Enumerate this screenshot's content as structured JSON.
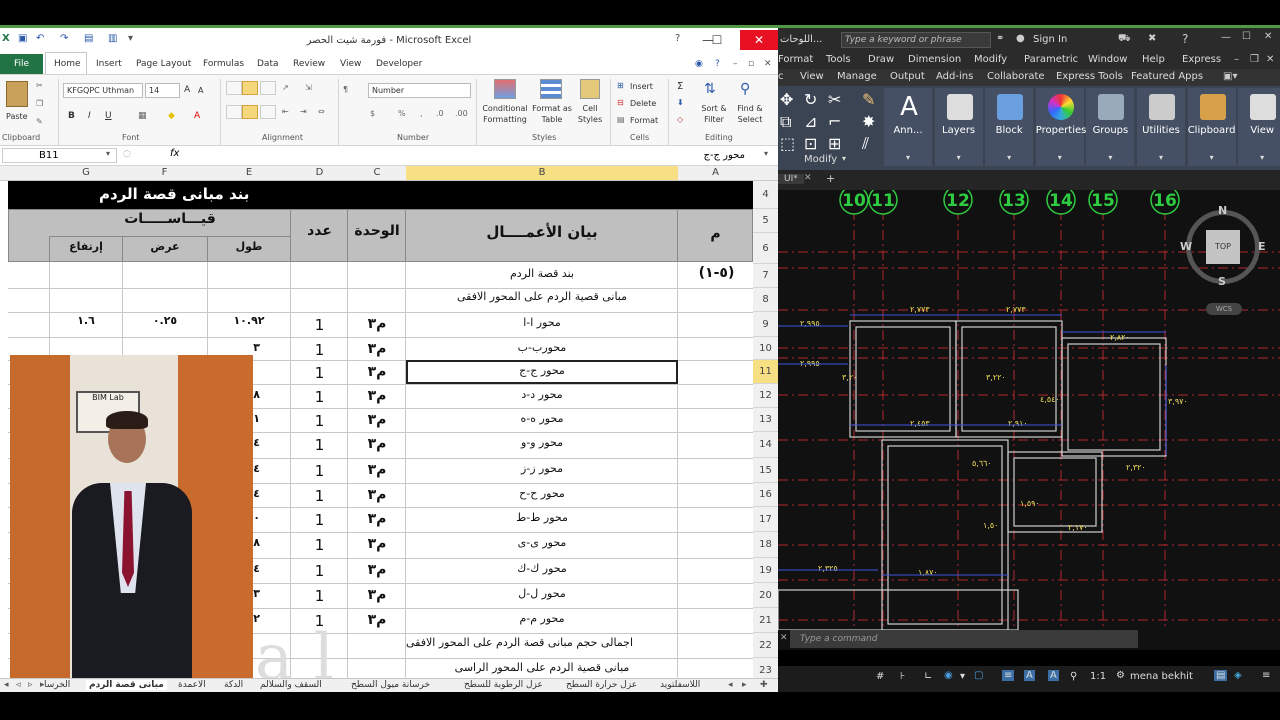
{
  "excel": {
    "title": "فورمة شيت الحصر - Microsoft Excel",
    "tabs": [
      "File",
      "Home",
      "Insert",
      "Page Layout",
      "Formulas",
      "Data",
      "Review",
      "View",
      "Developer"
    ],
    "font_name": "KFGQPC Uthman",
    "font_size": "14",
    "number_format": "Number",
    "groups": [
      "Clipboard",
      "Font",
      "Alignment",
      "Number",
      "Styles",
      "Cells",
      "Editing"
    ],
    "ribbon_labels": {
      "paste": "Paste",
      "conditional": "Conditional Formatting",
      "format_table": "Format as Table",
      "cell_styles": "Cell Styles",
      "insert": "Insert",
      "delete": "Delete",
      "format": "Format",
      "sort": "Sort & Filter",
      "find": "Find & Select"
    },
    "name_box": "B11",
    "formula": "محور ج-ج",
    "columns": [
      "G",
      "F",
      "E",
      "D",
      "C",
      "B",
      "A"
    ],
    "header_title": "بند مبانى قصة الردم",
    "header_m": "م",
    "header_desc": "بيان الأعمــــال",
    "header_unit": "الوحدة",
    "header_count": "عدد",
    "header_measure": "قيـــاســـــات",
    "header_length": "طول",
    "header_width": "عرض",
    "header_height": "إرتفاع",
    "item_no": "(٥-١)",
    "row7": "بند قصة الردم",
    "row8": "مبانى قصية الردم على المحور الافقى",
    "row9_length": "١٠.٩٢",
    "row9_width": "٠.٢٥",
    "row9_height": "١.٦",
    "axes": [
      {
        "row": "9",
        "name": "محور ا-ا",
        "unit": "م٣",
        "count": "1",
        "e": ""
      },
      {
        "row": "10",
        "name": "محورب-ب",
        "unit": "م٣",
        "count": "1",
        "e": "٣"
      },
      {
        "row": "11",
        "name": "محور ج-ج",
        "unit": "م٣",
        "count": "1",
        "e": ""
      },
      {
        "row": "12",
        "name": "محور د-د",
        "unit": "م٣",
        "count": "1",
        "e": "٦٨"
      },
      {
        "row": "13",
        "name": "محور ه-ه",
        "unit": "م٣",
        "count": "1",
        "e": "١"
      },
      {
        "row": "14",
        "name": "محور و-و",
        "unit": "م٣",
        "count": "1",
        "e": "٤"
      },
      {
        "row": "15",
        "name": "محور ز-ز",
        "unit": "م٣",
        "count": "1",
        "e": "٨٤"
      },
      {
        "row": "16",
        "name": "محور ح-ح",
        "unit": "م٣",
        "count": "1",
        "e": "٤"
      },
      {
        "row": "17",
        "name": "محور ط-ط",
        "unit": "م٣",
        "count": "1",
        "e": "٠"
      },
      {
        "row": "18",
        "name": "محور ى-ى",
        "unit": "م٣",
        "count": "1",
        "e": "٦٨"
      },
      {
        "row": "19",
        "name": "محور ك-ك",
        "unit": "م٣",
        "count": "1",
        "e": "٤"
      },
      {
        "row": "20",
        "name": "محور ل-ل",
        "unit": "م٣",
        "count": "1",
        "e": "٣"
      },
      {
        "row": "21",
        "name": "محور م-م",
        "unit": "م٣",
        "count": "1",
        "e": "٩٢"
      }
    ],
    "row22": "اجمالى حجم مبانى قصة الردم على المحور الافقى",
    "row23": "مبانى قصية الردم على المحور الراسى",
    "row_numbers": [
      "4",
      "5",
      "6",
      "7",
      "8",
      "9",
      "10",
      "11",
      "12",
      "13",
      "14",
      "15",
      "16",
      "17",
      "18",
      "19",
      "20",
      "21",
      "22",
      "23"
    ],
    "sheets": [
      "اللاسفلتويد",
      "عزل حرارة السطح",
      "عزل الرطوبة للسطح",
      "خرسانة ميول السطح",
      "السقف والسلالم",
      "الدكة",
      "الاعمدة",
      "مبانى قصة الردم",
      "الخرسا"
    ],
    "photo_sign": "BIM Lab"
  },
  "autocad": {
    "title_left": "اللوحات...",
    "search_placeholder": "Type a keyword or phrase",
    "sign_in": "Sign In",
    "menu": [
      "Format",
      "Tools",
      "Draw",
      "Dimension",
      "Modify",
      "Parametric",
      "Window",
      "Help",
      "Express"
    ],
    "tabs": [
      "View",
      "Manage",
      "Output",
      "Add-ins",
      "Collaborate",
      "Express Tools",
      "Featured Apps"
    ],
    "ribbon_buttons": [
      "Ann...",
      "Layers",
      "Block",
      "Properties",
      "Groups",
      "Utilities",
      "Clipboard",
      "View"
    ],
    "modify_label": "Modify",
    "file_tab": "UI*",
    "grid_labels": [
      "10",
      "11",
      "12",
      "13",
      "14",
      "15",
      "16"
    ],
    "compass": {
      "n": "N",
      "s": "S",
      "e": "E",
      "w": "W",
      "top": "TOP",
      "wcs": "WCS"
    },
    "dims": [
      "٢,٩٩٥",
      "٢,٧٧٣",
      "٢,٧٧٣",
      "٢,٩٩٥",
      "٢,٨٢٠",
      "٣,٢٠",
      "٣,٢٢٠",
      "٤,٥٤٠",
      "٢,٤٥٣",
      "٢,٩١٠",
      "٣,٩٧٠",
      "٥,٦٦٠",
      "٢,٣٢٠",
      "٢,٣٢٥",
      "١,٨٧٠",
      "١,٥٩٠",
      "٢,١٧٠",
      "١,٥٠"
    ],
    "command_placeholder": "Type a command",
    "scale": "1:1",
    "user": "mena bekhit"
  }
}
